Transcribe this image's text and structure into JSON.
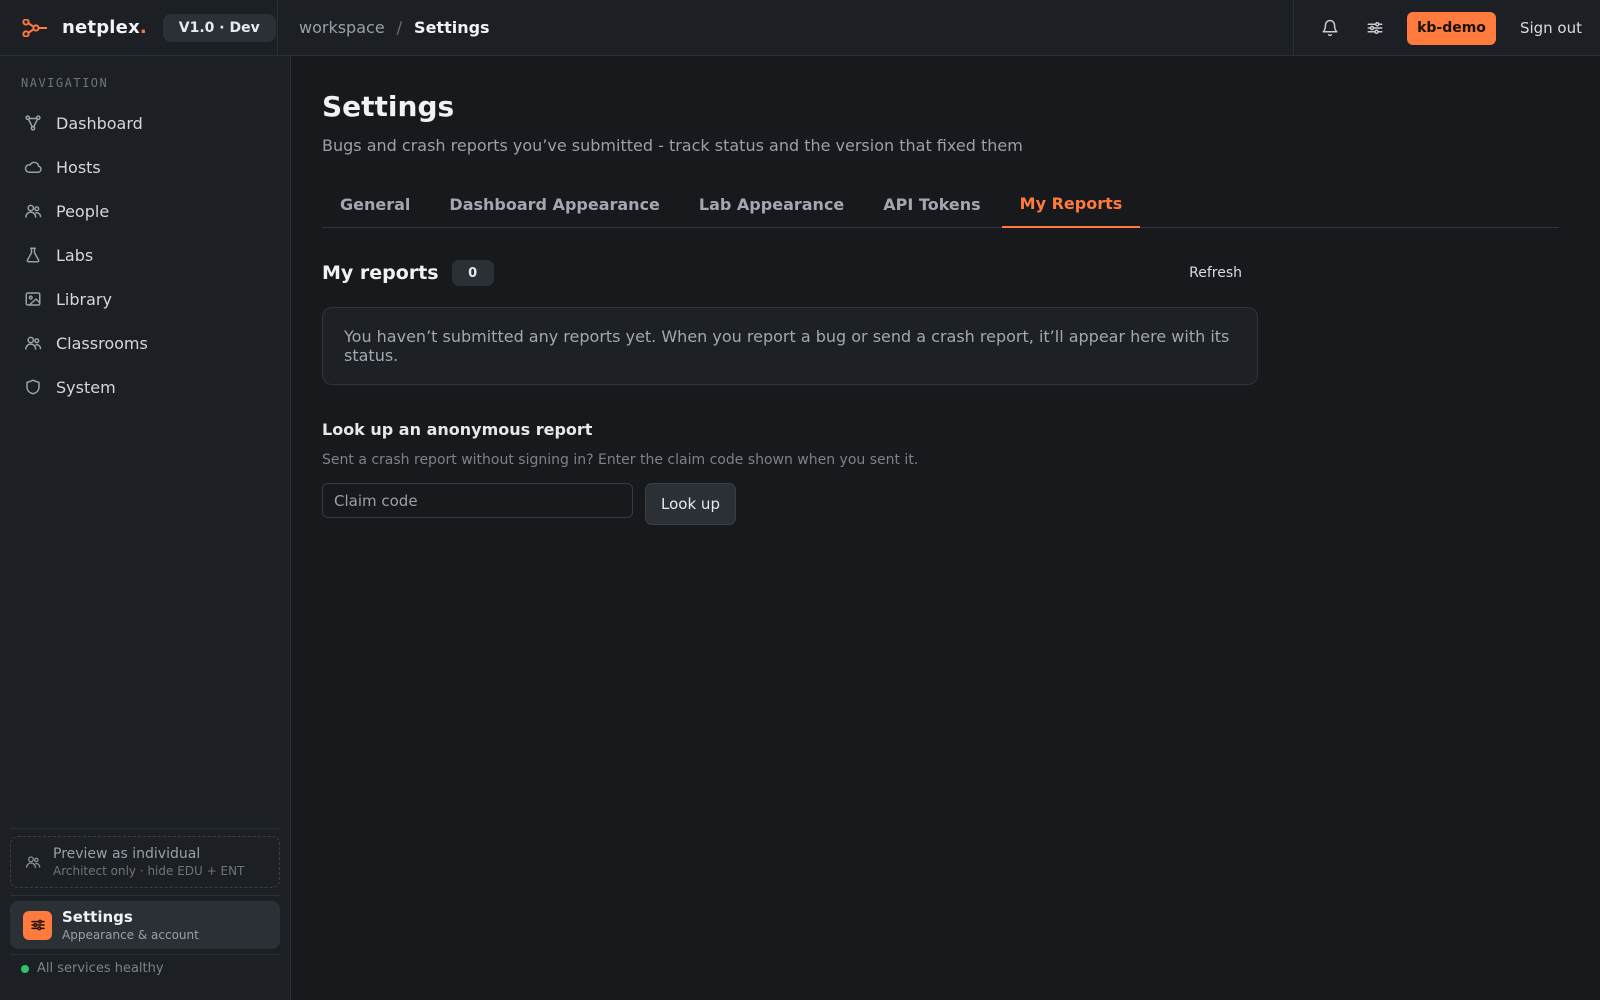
{
  "brand": {
    "name": "netplex",
    "dot": ".",
    "version": "V1.0 · Dev",
    "accent": "#ff7a3d"
  },
  "breadcrumb": {
    "parent": "workspace",
    "separator": "/",
    "current": "Settings"
  },
  "topbar": {
    "notifications_icon": "bell-icon",
    "preferences_icon": "sliders-icon",
    "user": "kb-demo",
    "sign_out": "Sign out"
  },
  "sidebar": {
    "heading": "NAVIGATION",
    "items": [
      {
        "label": "Dashboard",
        "icon": "graph-icon"
      },
      {
        "label": "Hosts",
        "icon": "cloud-icon"
      },
      {
        "label": "People",
        "icon": "users-icon"
      },
      {
        "label": "Labs",
        "icon": "flask-icon"
      },
      {
        "label": "Library",
        "icon": "image-icon"
      },
      {
        "label": "Classrooms",
        "icon": "users-icon"
      },
      {
        "label": "System",
        "icon": "shield-icon"
      }
    ],
    "preview": {
      "title": "Preview as individual",
      "subtitle": "Architect only · hide EDU + ENT"
    },
    "settings": {
      "title": "Settings",
      "subtitle": "Appearance & account"
    },
    "status": {
      "text": "All services healthy",
      "color": "#2fc46a"
    }
  },
  "main": {
    "title": "Settings",
    "description": "Bugs and crash reports you’ve submitted - track status and the version that fixed them",
    "tabs": [
      {
        "label": "General",
        "active": false
      },
      {
        "label": "Dashboard Appearance",
        "active": false
      },
      {
        "label": "Lab Appearance",
        "active": false
      },
      {
        "label": "API Tokens",
        "active": false
      },
      {
        "label": "My Reports",
        "active": true
      }
    ],
    "reports": {
      "title": "My reports",
      "count": "0",
      "refresh": "Refresh",
      "empty": "You haven’t submitted any reports yet. When you report a bug or send a crash report, it’ll appear here with its status."
    },
    "lookup": {
      "title": "Look up an anonymous report",
      "description": "Sent a crash report without signing in? Enter the claim code shown when you sent it.",
      "placeholder": "Claim code",
      "value": "",
      "button": "Look up"
    }
  }
}
